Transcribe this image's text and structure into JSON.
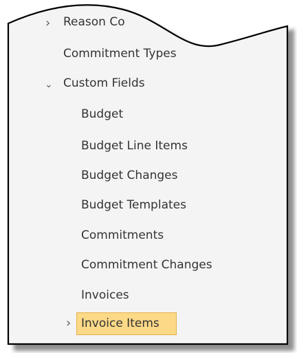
{
  "tree": {
    "reason_codes_partial": "Reason Co",
    "commitment_types": "Commitment Types",
    "custom_fields": "Custom Fields",
    "children": [
      "Budget",
      "Budget Line Items",
      "Budget Changes",
      "Budget Templates",
      "Commitments",
      "Commitment Changes"
    ],
    "invoices": "Invoices",
    "invoice_items": "Invoice Items"
  },
  "icons": {
    "collapsed": "chevron-right-icon",
    "expanded": "chevron-down-icon"
  },
  "colors": {
    "selection_fill": "#fbd987",
    "selection_border": "#e6b04a",
    "panel_background": "#f4f4f4",
    "text": "#333333"
  }
}
